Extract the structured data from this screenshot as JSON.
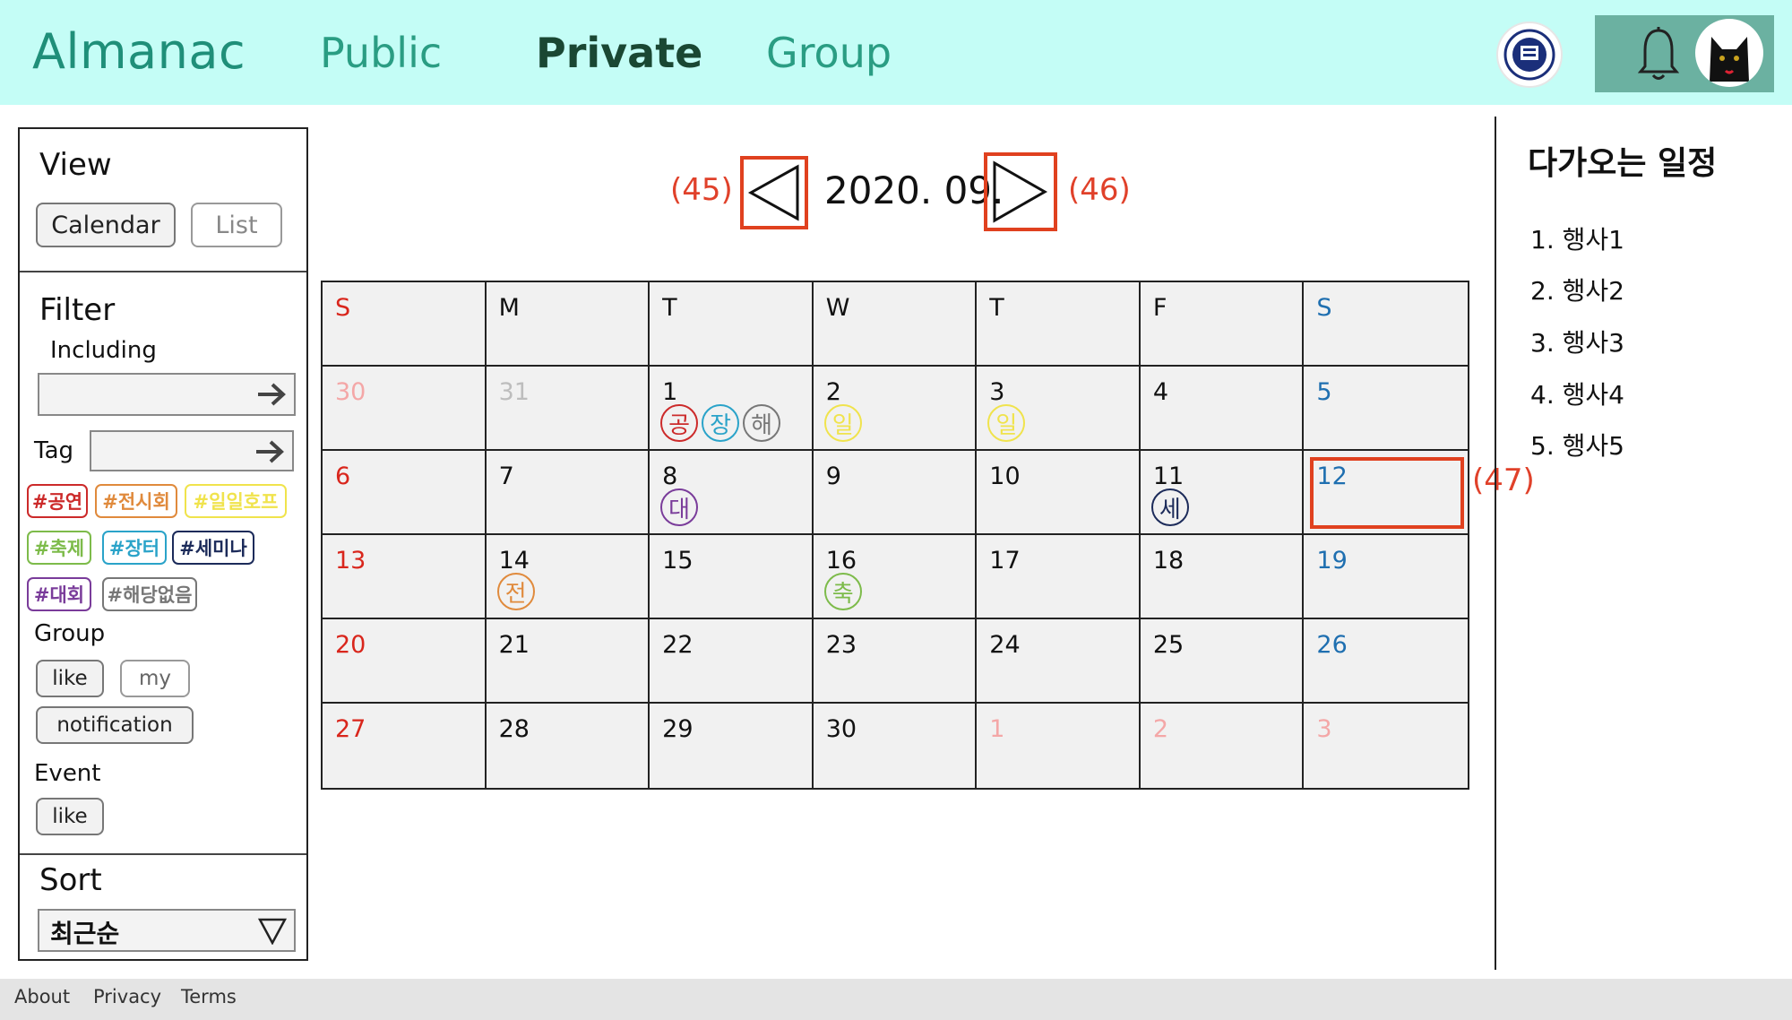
{
  "header": {
    "brand": "Almanac",
    "nav": {
      "public": "Public",
      "private": "Private",
      "group": "Group"
    },
    "icons": [
      "university-emblem-icon",
      "bell-icon",
      "cat-avatar-icon"
    ],
    "colors": {
      "header_bg": "#c4fdf6",
      "accent": "#1f8f79",
      "bell_bg": "#6bb1a1"
    }
  },
  "sidebar": {
    "view": {
      "title": "View",
      "calendar": "Calendar",
      "list": "List"
    },
    "filter": {
      "title": "Filter",
      "including": "Including",
      "tag": "Tag"
    },
    "tags": [
      {
        "label": "#공연",
        "color": "#cc2a2a"
      },
      {
        "label": "#전시회",
        "color": "#e08a3c"
      },
      {
        "label": "#일일호프",
        "color": "#f0e34c"
      },
      {
        "label": "#축제",
        "color": "#7dbb4a"
      },
      {
        "label": "#장터",
        "color": "#2aa3c9"
      },
      {
        "label": "#세미나",
        "color": "#1c2b5a"
      },
      {
        "label": "#대회",
        "color": "#7a3c9a"
      },
      {
        "label": "#해당없음",
        "color": "#777777"
      }
    ],
    "group": {
      "title": "Group",
      "like": "like",
      "my": "my",
      "notification": "notification"
    },
    "event": {
      "title": "Event",
      "like": "like"
    },
    "sort": {
      "title": "Sort",
      "selected": "최근순"
    }
  },
  "calendar": {
    "prev_caption": "(45)",
    "next_caption": "(46)",
    "month_title": "2020. 09.",
    "highlight_caption": "(47)",
    "weekdays": [
      "S",
      "M",
      "T",
      "W",
      "T",
      "F",
      "S"
    ],
    "weeks": [
      [
        "30",
        "31",
        "1",
        "2",
        "3",
        "4",
        "5"
      ],
      [
        "6",
        "7",
        "8",
        "9",
        "10",
        "11",
        "12"
      ],
      [
        "13",
        "14",
        "15",
        "16",
        "17",
        "18",
        "19"
      ],
      [
        "20",
        "21",
        "22",
        "23",
        "24",
        "25",
        "26"
      ],
      [
        "27",
        "28",
        "29",
        "30",
        "1",
        "2",
        "3"
      ]
    ],
    "events": [
      {
        "week": 0,
        "day": 2,
        "marks": [
          {
            "text": "공",
            "color": "#cc2a2a"
          },
          {
            "text": "장",
            "color": "#2aa3c9"
          },
          {
            "text": "해",
            "color": "#777777"
          }
        ]
      },
      {
        "week": 0,
        "day": 3,
        "marks": [
          {
            "text": "일",
            "color": "#f0e34c"
          }
        ]
      },
      {
        "week": 0,
        "day": 4,
        "marks": [
          {
            "text": "일",
            "color": "#f0e34c"
          }
        ]
      },
      {
        "week": 1,
        "day": 2,
        "marks": [
          {
            "text": "대",
            "color": "#7a3c9a"
          }
        ]
      },
      {
        "week": 1,
        "day": 5,
        "marks": [
          {
            "text": "세",
            "color": "#1c2b5a"
          }
        ]
      },
      {
        "week": 2,
        "day": 1,
        "marks": [
          {
            "text": "전",
            "color": "#e08a3c"
          }
        ]
      },
      {
        "week": 2,
        "day": 3,
        "marks": [
          {
            "text": "축",
            "color": "#7dbb4a"
          }
        ]
      }
    ],
    "colors": {
      "sunday": "#d9261c",
      "saturday": "#1f6fb0",
      "weekday": "#111111",
      "outside_month": "#f4a7a7",
      "outside_prev": "#bdbdbd"
    }
  },
  "upcoming": {
    "title": "다가오는 일정",
    "items": [
      "1. 행사1",
      "2. 행사2",
      "3. 행사3",
      "4. 행사4",
      "5. 행사5"
    ]
  },
  "footer": {
    "about": "About",
    "privacy": "Privacy",
    "terms": "Terms"
  }
}
